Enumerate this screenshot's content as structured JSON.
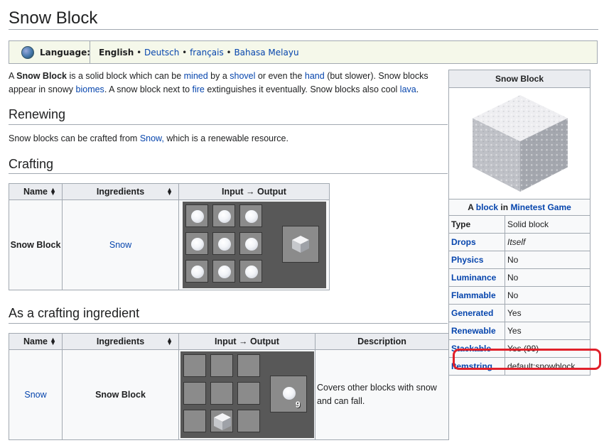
{
  "page": {
    "title": "Snow Block",
    "language": {
      "label": "Language:",
      "current": "English",
      "sep1": " • ",
      "others": [
        "Deutsch",
        "français",
        "Bahasa Melayu"
      ]
    },
    "intro": {
      "p1": "A ",
      "bold": "Snow Block",
      "p2": " is a solid block which can be ",
      "l_mined": "mined",
      "p3": " by a ",
      "l_shovel": "shovel",
      "p4": " or even the ",
      "l_hand": "hand",
      "p5": " (but slower). Snow blocks appear in snowy ",
      "l_biomes": "biomes",
      "p6": ". A snow block next to ",
      "l_fire": "fire",
      "p7": " extinguishes it eventually. Snow blocks also cool ",
      "l_lava": "lava",
      "p8": "."
    },
    "renewing": {
      "heading": "Renewing",
      "t1": "Snow blocks can be crafted from ",
      "link": "Snow,",
      "t2": " which is a renewable resource."
    },
    "crafting": {
      "heading": "Crafting",
      "headers": [
        "Name",
        "Ingredients",
        "Input → Output"
      ],
      "row": {
        "name": "Snow Block",
        "ingredient": "Snow"
      }
    },
    "ingredient": {
      "heading": "As a crafting ingredient",
      "headers": [
        "Name",
        "Ingredients",
        "Input → Output",
        "Description"
      ],
      "row": {
        "name": "Snow",
        "ingredient": "Snow Block",
        "count": "9",
        "description": "Covers other blocks with snow and can fall."
      }
    }
  },
  "infobox": {
    "title": "Snow Block",
    "caption_a": "A ",
    "caption_link1": "block",
    "caption_in": " in ",
    "caption_link2": "Minetest Game",
    "rows": [
      {
        "key": "Type",
        "value": "Solid block"
      },
      {
        "key": "Drops",
        "value": "Itself"
      },
      {
        "key": "Physics",
        "value": "No"
      },
      {
        "key": "Luminance",
        "value": "No"
      },
      {
        "key": "Flammable",
        "value": "No"
      },
      {
        "key": "Generated",
        "value": "Yes"
      },
      {
        "key": "Renewable",
        "value": "Yes"
      },
      {
        "key": "Stackable",
        "value": "Yes (99)"
      },
      {
        "key": "Itemstring",
        "value": "default:snowblock"
      }
    ]
  },
  "colors": {
    "link": "#0645ad",
    "highlight": "#e0202a",
    "lang_bg": "#f5f8ea"
  }
}
